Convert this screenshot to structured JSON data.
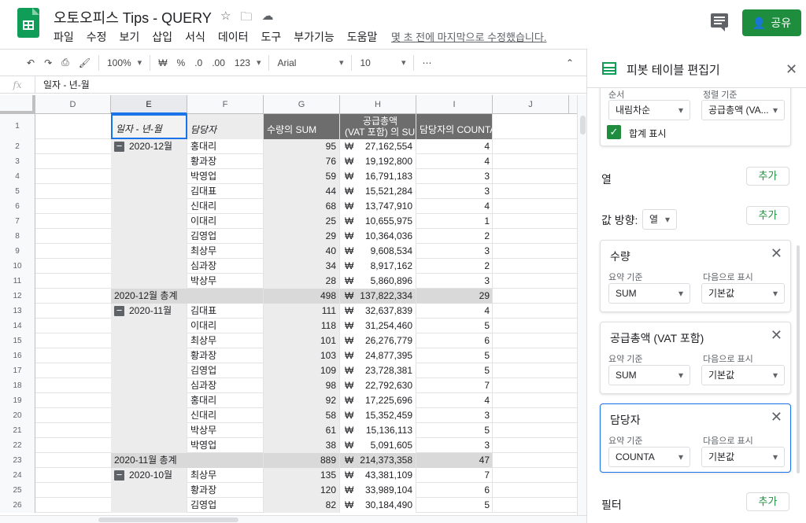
{
  "app": {
    "doc_title": "오토오피스 Tips - QUERY",
    "menu": [
      "파일",
      "수정",
      "보기",
      "삽입",
      "서식",
      "데이터",
      "도구",
      "부가기능",
      "도움말"
    ],
    "last_edit": "몇 초 전에 마지막으로 수정했습니다.",
    "share_label": "공유"
  },
  "toolbar": {
    "zoom": "100%",
    "currency": "₩",
    "percent": "%",
    "dec_less": ".0",
    "dec_more": ".00",
    "format_more": "123",
    "font": "Arial",
    "font_size": "10",
    "more": "⋯",
    "collapse": "⌃"
  },
  "formula_bar": {
    "fx": "fx",
    "content": "일자 - 년-월"
  },
  "sheet": {
    "columns": [
      "D",
      "E",
      "F",
      "G",
      "H",
      "I",
      "J"
    ],
    "header_row": {
      "row": "1",
      "e": "일자 - 년-월",
      "f": "담당자",
      "g": "수량의 SUM",
      "h_line1": "공급총액",
      "h_line2": "(VAT 포함) 의 SUM",
      "i": "담당자의 COUNTA"
    },
    "rows": [
      {
        "n": "2",
        "group": "2020-12월",
        "name": "홍대리",
        "qty": "95",
        "amount": "27,162,554",
        "count": "4"
      },
      {
        "n": "3",
        "name": "황과장",
        "qty": "76",
        "amount": "19,192,800",
        "count": "4"
      },
      {
        "n": "4",
        "name": "박영업",
        "qty": "59",
        "amount": "16,791,183",
        "count": "3"
      },
      {
        "n": "5",
        "name": "김대표",
        "qty": "44",
        "amount": "15,521,284",
        "count": "3"
      },
      {
        "n": "6",
        "name": "신대리",
        "qty": "68",
        "amount": "13,747,910",
        "count": "4"
      },
      {
        "n": "7",
        "name": "이대리",
        "qty": "25",
        "amount": "10,655,975",
        "count": "1"
      },
      {
        "n": "8",
        "name": "김영업",
        "qty": "29",
        "amount": "10,364,036",
        "count": "2"
      },
      {
        "n": "9",
        "name": "최상무",
        "qty": "40",
        "amount": "9,608,534",
        "count": "3"
      },
      {
        "n": "10",
        "name": "심과장",
        "qty": "34",
        "amount": "8,917,162",
        "count": "2"
      },
      {
        "n": "11",
        "name": "박상무",
        "qty": "28",
        "amount": "5,860,896",
        "count": "3"
      },
      {
        "n": "12",
        "total": "2020-12월 총계",
        "qty": "498",
        "amount": "137,822,334",
        "count": "29"
      },
      {
        "n": "13",
        "group": "2020-11월",
        "name": "김대표",
        "qty": "111",
        "amount": "32,637,839",
        "count": "4"
      },
      {
        "n": "14",
        "name": "이대리",
        "qty": "118",
        "amount": "31,254,460",
        "count": "5"
      },
      {
        "n": "15",
        "name": "최상무",
        "qty": "101",
        "amount": "26,276,779",
        "count": "6"
      },
      {
        "n": "16",
        "name": "황과장",
        "qty": "103",
        "amount": "24,877,395",
        "count": "5"
      },
      {
        "n": "17",
        "name": "김영업",
        "qty": "109",
        "amount": "23,728,381",
        "count": "5"
      },
      {
        "n": "18",
        "name": "심과장",
        "qty": "98",
        "amount": "22,792,630",
        "count": "7"
      },
      {
        "n": "19",
        "name": "홍대리",
        "qty": "92",
        "amount": "17,225,696",
        "count": "4"
      },
      {
        "n": "20",
        "name": "신대리",
        "qty": "58",
        "amount": "15,352,459",
        "count": "3"
      },
      {
        "n": "21",
        "name": "박상무",
        "qty": "61",
        "amount": "15,136,113",
        "count": "5"
      },
      {
        "n": "22",
        "name": "박영업",
        "qty": "38",
        "amount": "5,091,605",
        "count": "3"
      },
      {
        "n": "23",
        "total": "2020-11월 총계",
        "qty": "889",
        "amount": "214,373,358",
        "count": "47"
      },
      {
        "n": "24",
        "group": "2020-10월",
        "name": "최상무",
        "qty": "135",
        "amount": "43,381,109",
        "count": "7"
      },
      {
        "n": "25",
        "name": "황과장",
        "qty": "120",
        "amount": "33,989,104",
        "count": "6"
      },
      {
        "n": "26",
        "name": "김영업",
        "qty": "82",
        "amount": "30,184,490",
        "count": "5"
      }
    ]
  },
  "panel": {
    "title": "피봇 테이블 편집기",
    "top_card": {
      "order_label": "순서",
      "order_value": "내림차순",
      "sort_label": "정렬 기준",
      "sort_value": "공급총액 (VA...",
      "show_totals": "합계 표시"
    },
    "columns_label": "열",
    "add_label": "추가",
    "values_direction_label": "값 방향:",
    "values_direction_value": "열",
    "value_cards": [
      {
        "title": "수량",
        "summarize_label": "요약 기준",
        "summarize_value": "SUM",
        "show_as_label": "다음으로 표시",
        "show_as_value": "기본값"
      },
      {
        "title": "공급총액 (VAT 포함)",
        "summarize_label": "요약 기준",
        "summarize_value": "SUM",
        "show_as_label": "다음으로 표시",
        "show_as_value": "기본값"
      },
      {
        "title": "담당자",
        "summarize_label": "요약 기준",
        "summarize_value": "COUNTA",
        "show_as_label": "다음으로 표시",
        "show_as_value": "기본값"
      }
    ],
    "filter_label": "필터"
  },
  "colors": {
    "brand_green": "#0f9d58",
    "share_green": "#1e8e3e",
    "header_dark": "#6d6d6d",
    "total_gray": "#d9d9d9",
    "selection_blue": "#1a73e8"
  }
}
